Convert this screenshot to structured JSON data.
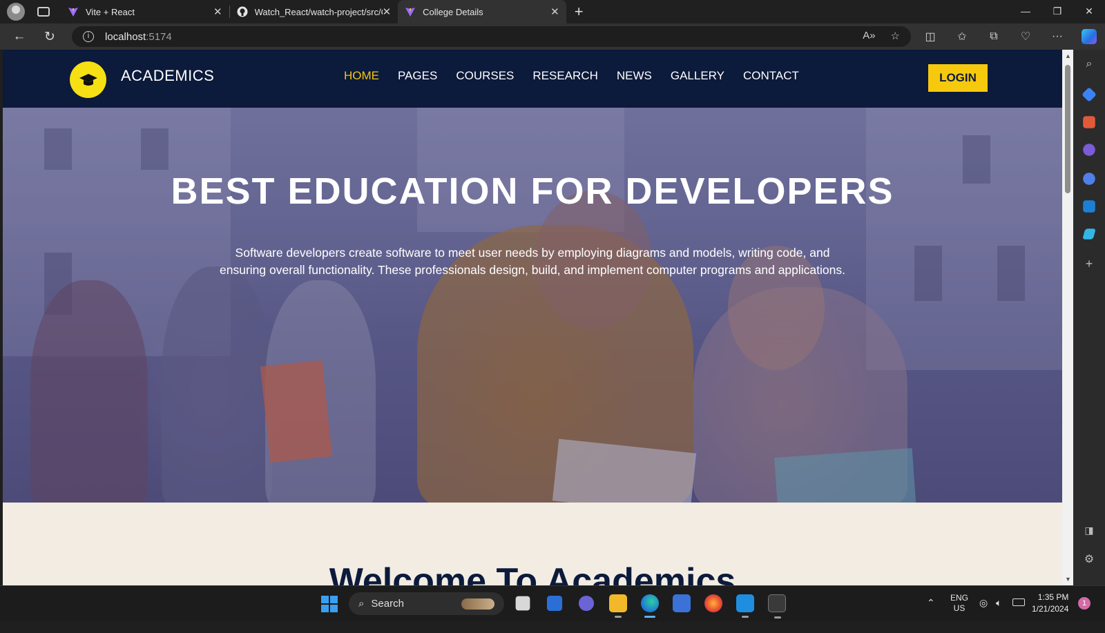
{
  "browser": {
    "tabs": [
      {
        "label": "Vite + React",
        "favicon": "vite-icon",
        "active": false
      },
      {
        "label": "Watch_React/watch-project/src/C",
        "favicon": "github-icon",
        "active": false
      },
      {
        "label": "College Details",
        "favicon": "vite-icon",
        "active": true
      }
    ],
    "address": {
      "host": "localhost",
      "port": ":5174"
    }
  },
  "site": {
    "brand": "ACADEMICS",
    "menu": [
      {
        "label": "HOME",
        "active": true
      },
      {
        "label": "PAGES",
        "active": false
      },
      {
        "label": "COURSES",
        "active": false
      },
      {
        "label": "RESEARCH",
        "active": false
      },
      {
        "label": "NEWS",
        "active": false
      },
      {
        "label": "GALLERY",
        "active": false
      },
      {
        "label": "CONTACT",
        "active": false
      }
    ],
    "login_label": "LOGIN",
    "hero": {
      "title": "BEST EDUCATION FOR DEVELOPERS",
      "text": "Software developers create software to meet user needs by employing diagrams and models, writing code, and ensuring overall functionality. These professionals design, build, and implement computer programs and applications."
    },
    "welcome_heading": "Welcome To Academics"
  },
  "taskbar": {
    "search_placeholder": "Search",
    "lang_line1": "ENG",
    "lang_line2": "US",
    "time": "1:35 PM",
    "date": "1/21/2024",
    "notification_count": "1"
  },
  "colors": {
    "header_bg": "#0c1a3b",
    "accent_yellow": "#f6c90e",
    "active_menu": "#f6c70c",
    "page_bg": "#f2ece2"
  }
}
